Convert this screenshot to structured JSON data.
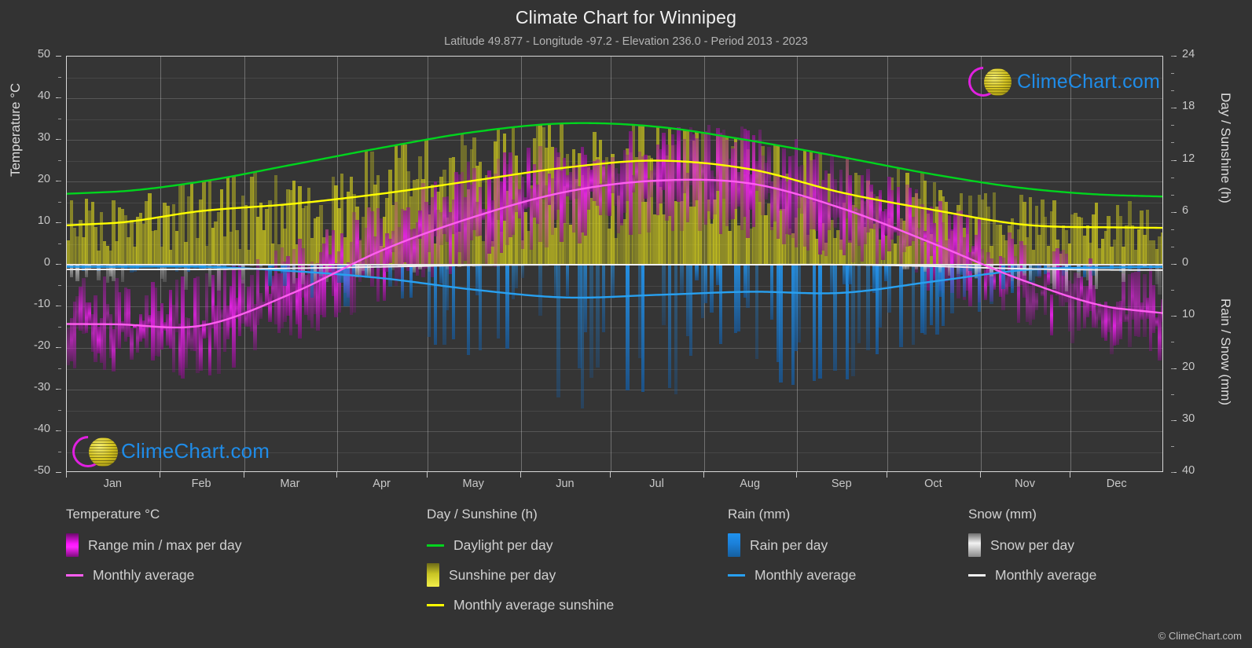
{
  "header": {
    "title": "Climate Chart for Winnipeg",
    "subtitle": "Latitude 49.877 - Longitude -97.2 - Elevation 236.0 - Period 2013 - 2023"
  },
  "axes": {
    "left_title": "Temperature °C",
    "right_top_title": "Day / Sunshine (h)",
    "right_bottom_title": "Rain / Snow (mm)",
    "left_ticks": [
      "50",
      "40",
      "30",
      "20",
      "10",
      "0",
      "-10",
      "-20",
      "-30",
      "-40",
      "-50"
    ],
    "right_top_ticks": [
      "24",
      "18",
      "12",
      "6",
      "0"
    ],
    "right_bottom_ticks": [
      "0",
      "10",
      "20",
      "30",
      "40"
    ],
    "x_ticks": [
      "Jan",
      "Feb",
      "Mar",
      "Apr",
      "May",
      "Jun",
      "Jul",
      "Aug",
      "Sep",
      "Oct",
      "Nov",
      "Dec"
    ]
  },
  "legend": {
    "temperature": {
      "title": "Temperature °C",
      "range_label": "Range min / max per day",
      "average_label": "Monthly average"
    },
    "daysun": {
      "title": "Day / Sunshine (h)",
      "daylight_label": "Daylight per day",
      "sunshine_label": "Sunshine per day",
      "average_label": "Monthly average sunshine"
    },
    "rain": {
      "title": "Rain (mm)",
      "per_day_label": "Rain per day",
      "average_label": "Monthly average"
    },
    "snow": {
      "title": "Snow (mm)",
      "per_day_label": "Snow per day",
      "average_label": "Monthly average"
    }
  },
  "watermark": {
    "brand": "ClimeChart.com",
    "copyright": "© ClimeChart.com"
  },
  "colors": {
    "background": "#333333",
    "plot_background": "#353535",
    "temperature_range": "#cc16cc",
    "temperature_avg": "#ff5ef0",
    "daylight": "#00d41e",
    "sunshine_fill": "#c8c81e",
    "sunshine_avg": "#ffff00",
    "rain": "#1f8ce8",
    "rain_avg": "#28a0f0",
    "snow": "#d0d0d0",
    "snow_avg": "#f0f0f0",
    "grid": "#d2d2d2",
    "text": "#c8c8c8",
    "brand_blue": "#1f8ce8",
    "brand_magenta": "#e020e0",
    "brand_yellow": "#d8c81a"
  },
  "chart_data": {
    "type": "line",
    "title": "Climate Chart for Winnipeg",
    "subtitle": "Latitude 49.877 - Longitude -97.2 - Elevation 236.0 - Period 2013 - 2023",
    "xlabel": "",
    "ylabel": "Temperature °C",
    "ylim": [
      -50,
      50
    ],
    "y2_top_label": "Day / Sunshine (h)",
    "y2_top_lim": [
      0,
      24
    ],
    "y2_bottom_label": "Rain / Snow (mm)",
    "y2_bottom_lim": [
      0,
      40
    ],
    "grid": true,
    "legend_position": "below",
    "categories": [
      "Jan",
      "Feb",
      "Mar",
      "Apr",
      "May",
      "Jun",
      "Jul",
      "Aug",
      "Sep",
      "Oct",
      "Nov",
      "Dec"
    ],
    "series": [
      {
        "name": "Monthly average temperature (°C)",
        "axis": "left",
        "color": "#ff5ef0",
        "values": [
          -14.3,
          -14.6,
          -7.0,
          3.5,
          11.5,
          17.5,
          20.2,
          19.5,
          13.5,
          5.0,
          -4.0,
          -10.5
        ]
      },
      {
        "name": "Monthly average daily max temperature (°C)",
        "axis": "left",
        "color": "#cc16cc",
        "values": [
          -9.0,
          -8.5,
          -1.0,
          10.0,
          19.0,
          24.5,
          27.0,
          26.5,
          20.0,
          11.0,
          0.5,
          -6.0
        ]
      },
      {
        "name": "Monthly average daily min temperature (°C)",
        "axis": "left",
        "color": "#cc16cc",
        "values": [
          -20.0,
          -20.5,
          -13.0,
          -2.5,
          4.5,
          11.0,
          13.5,
          12.5,
          7.0,
          -1.0,
          -8.5,
          -16.0
        ]
      },
      {
        "name": "Daylight per day (h)",
        "axis": "right_top",
        "color": "#00d41e",
        "values": [
          8.4,
          9.6,
          11.5,
          13.5,
          15.3,
          16.3,
          15.9,
          14.3,
          12.4,
          10.4,
          8.8,
          8.0
        ]
      },
      {
        "name": "Monthly average sunshine (h)",
        "axis": "right_top",
        "color": "#ffff00",
        "values": [
          4.8,
          6.2,
          7.0,
          8.2,
          9.7,
          11.2,
          12.0,
          11.0,
          8.3,
          6.3,
          4.6,
          4.3
        ]
      },
      {
        "name": "Monthly average rain (mm)",
        "axis": "right_bottom",
        "color": "#28a0f0",
        "values": [
          0.4,
          0.4,
          1.2,
          2.6,
          4.8,
          6.3,
          5.8,
          5.2,
          5.4,
          3.2,
          1.0,
          0.5
        ]
      },
      {
        "name": "Monthly average snow (mm)",
        "axis": "right_bottom",
        "color": "#f0f0f0",
        "values": [
          0.9,
          0.9,
          0.7,
          0.4,
          0.1,
          0.0,
          0.0,
          0.0,
          0.0,
          0.3,
          0.8,
          1.0
        ]
      }
    ]
  }
}
